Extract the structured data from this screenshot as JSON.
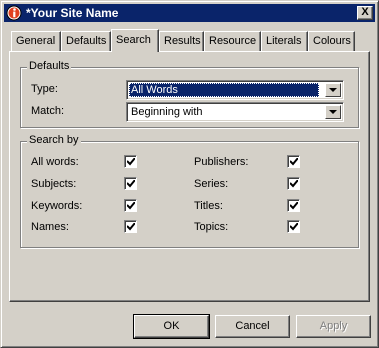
{
  "window": {
    "title": "*Your Site Name",
    "close_label": "X"
  },
  "tabs": [
    {
      "label": "General"
    },
    {
      "label": "Defaults"
    },
    {
      "label": "Search",
      "active": true
    },
    {
      "label": "Results"
    },
    {
      "label": "Resource"
    },
    {
      "label": "Literals"
    },
    {
      "label": "Colours"
    }
  ],
  "defaults_group": {
    "title": "Defaults",
    "type_label": "Type:",
    "type_value": "All Words",
    "match_label": "Match:",
    "match_value": "Beginning with"
  },
  "searchby_group": {
    "title": "Search by",
    "left": [
      {
        "label": "All words:",
        "checked": true
      },
      {
        "label": "Subjects:",
        "checked": true
      },
      {
        "label": "Keywords:",
        "checked": true
      },
      {
        "label": "Names:",
        "checked": true
      }
    ],
    "right": [
      {
        "label": "Publishers:",
        "checked": true
      },
      {
        "label": "Series:",
        "checked": true
      },
      {
        "label": "Titles:",
        "checked": true
      },
      {
        "label": "Topics:",
        "checked": true
      }
    ]
  },
  "buttons": {
    "ok": "OK",
    "cancel": "Cancel",
    "apply": "Apply"
  },
  "colors": {
    "titlebar": "#0a246a",
    "face": "#d4d0c8",
    "selection": "#0a246a"
  }
}
